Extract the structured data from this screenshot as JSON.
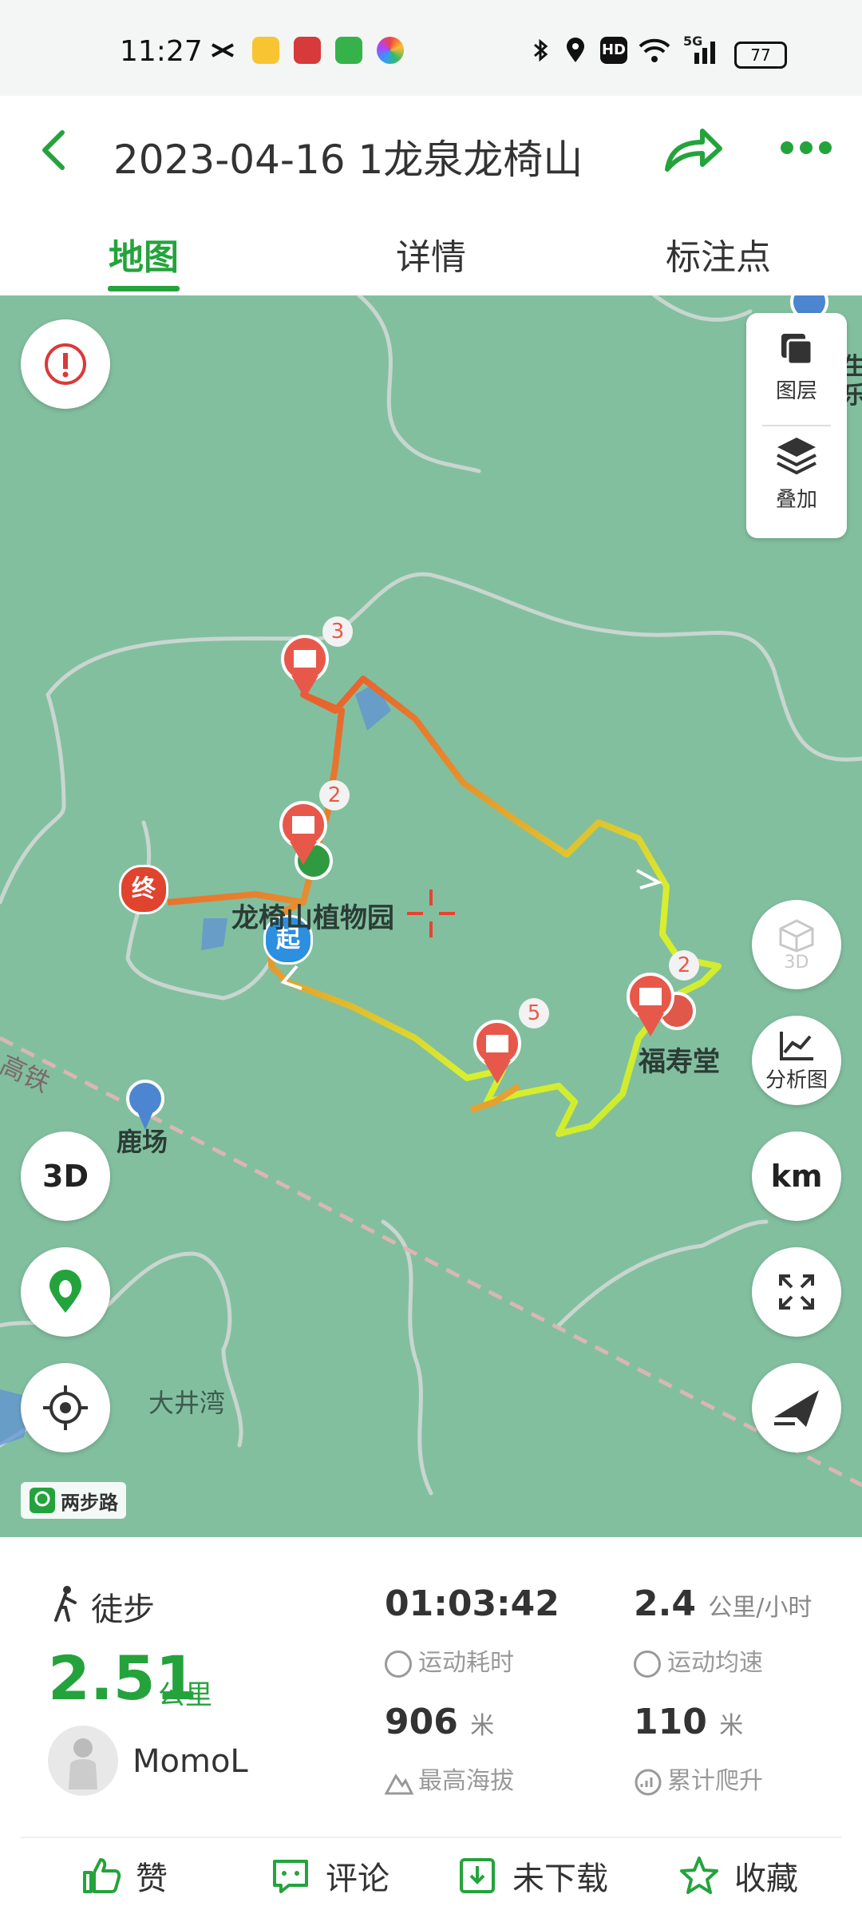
{
  "status_bar": {
    "time": "11:27",
    "battery": "77",
    "network": "5G",
    "hd": "HD"
  },
  "header": {
    "title": "2023-04-16 1龙泉龙椅山"
  },
  "tabs": [
    {
      "label": "地图",
      "active": true
    },
    {
      "label": "详情",
      "active": false
    },
    {
      "label": "标注点",
      "active": false
    }
  ],
  "map": {
    "layers_label": "图层",
    "overlay_label": "叠加",
    "btn_3d_disabled": "3D",
    "analysis_label": "分析图",
    "km_label": "km",
    "btn_3d": "3D",
    "labels": {
      "botanical_garden": "龙椅山植物园",
      "fushou": "福寿堂",
      "luchang": "鹿场",
      "dajingwan": "大井湾",
      "highspeed_rail": "高铁",
      "edge_text_1": "生",
      "edge_text_2": "乐"
    },
    "markers": {
      "start": "起",
      "end": "终"
    },
    "photo_counts": [
      "3",
      "2",
      "2",
      "5"
    ],
    "watermark": "两步路"
  },
  "stats": {
    "activity": "徒步",
    "distance": "2.51",
    "distance_unit": "公里",
    "user": "MomoL",
    "duration": "01:03:42",
    "duration_label": "运动耗时",
    "avg_speed": "2.4",
    "avg_speed_unit": "公里/小时",
    "avg_speed_label": "运动均速",
    "max_alt": "906",
    "max_alt_unit": "米",
    "max_alt_label": "最高海拔",
    "ascent": "110",
    "ascent_unit": "米",
    "ascent_label": "累计爬升"
  },
  "actions": {
    "like": "赞",
    "comment": "评论",
    "download": "未下载",
    "favorite": "收藏"
  },
  "colors": {
    "accent": "#24a33c",
    "map_bg": "#82bf9f",
    "track_hot": "#e8432d",
    "track_cool": "#d9ef2e"
  }
}
